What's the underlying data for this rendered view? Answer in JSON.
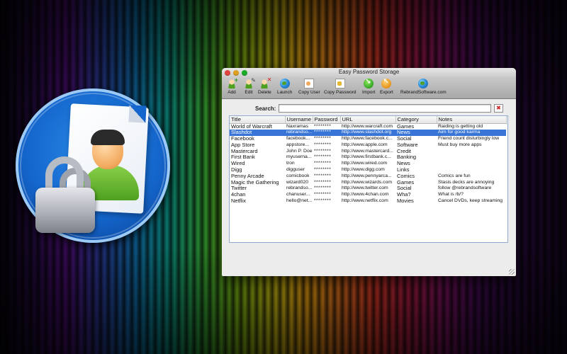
{
  "window": {
    "title": "Easy Password Storage"
  },
  "toolbar": {
    "add": "Add",
    "edit": "Edit",
    "delete": "Delete",
    "launch": "Launch",
    "copy_user": "Copy User",
    "copy_password": "Copy Password",
    "import": "Import",
    "export": "Export",
    "rebrand": "RebrandSoftware.com"
  },
  "search": {
    "label": "Search:",
    "value": "",
    "clear_icon": "clear-icon"
  },
  "table": {
    "columns": [
      "Title",
      "Username",
      "Password",
      "URL",
      "Category",
      "Notes"
    ],
    "selected_index": 1,
    "rows": [
      [
        "World of Warcraft",
        "Naxramas",
        "********",
        "http://www.warcraft.com",
        "Games",
        "Raiding is getting old"
      ],
      [
        "Slashdot",
        "rebrandso...",
        "********",
        "http://www.slashdot.org",
        "News",
        "Aim for good karma"
      ],
      [
        "Facebook",
        "facebook...",
        "********",
        "http://www.facebook.c...",
        "Social",
        "Friend count disturbingly low"
      ],
      [
        "App Store",
        "appstore...",
        "********",
        "http://www.apple.com",
        "Software",
        "Must buy more apps"
      ],
      [
        "Mastercard",
        "John P. Doe",
        "********",
        "http://www.mastercard...",
        "Credit",
        ""
      ],
      [
        "First Bank",
        "myuserna...",
        "********",
        "http://www.firstbank.c...",
        "Banking",
        ""
      ],
      [
        "Wired",
        "tron",
        "********",
        "http://www.wired.com",
        "News",
        ""
      ],
      [
        "Digg",
        "digguser",
        "********",
        "http://www.digg.com",
        "Links",
        ""
      ],
      [
        "Penny Arcade",
        "comicbook",
        "********",
        "http://www.pennyarca...",
        "Comics",
        "Comics are fun"
      ],
      [
        "Magic the Gathering",
        "wizard020",
        "********",
        "http://www.wizards.com",
        "Games",
        "Stasis decks are annoying"
      ],
      [
        "Twitter",
        "rebrandso...",
        "********",
        "http://www.twitter.com",
        "Social",
        "follow @rebrandsoftware"
      ],
      [
        "4chan",
        "chanuser...",
        "********",
        "http://www.4chan.com",
        "Wha?",
        "What is /b/?"
      ],
      [
        "Netflix",
        "hello@net...",
        "********",
        "http://www.netflix.com",
        "Movies",
        "Cancel DVDs, keep streaming"
      ]
    ]
  },
  "colors": {
    "selection": "#3875d7",
    "icon_blue": "#1466cc"
  }
}
